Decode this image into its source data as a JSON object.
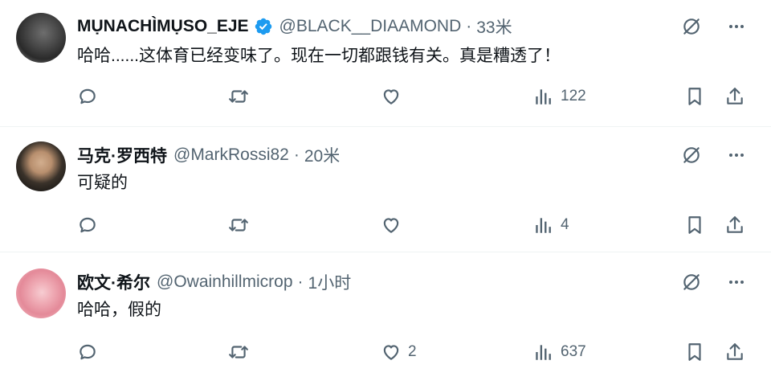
{
  "tweets": [
    {
      "name": "MỤNACHÌMỤSO_EJE",
      "handle": "@BLACK__DIAAMOND",
      "dot": "·",
      "time": "33米",
      "verified": true,
      "text": "哈哈......这体育已经变味了。现在一切都跟钱有关。真是糟透了！",
      "likes": "",
      "views": "122",
      "avatar_colors": [
        "#3a3a3a",
        "#8a8a8a"
      ]
    },
    {
      "name": "马克·罗西特",
      "handle": "@MarkRossi82",
      "dot": "·",
      "time": "20米",
      "verified": false,
      "text": "可疑的",
      "likes": "",
      "views": "4",
      "avatar_colors": [
        "#2b2620",
        "#c9a98a"
      ]
    },
    {
      "name": "欧文·希尔",
      "handle": "@Owainhillmicrop",
      "dot": "·",
      "time": "1小时",
      "verified": false,
      "text": "哈哈，假的",
      "likes": "2",
      "views": "637",
      "avatar_colors": [
        "#e89aa6",
        "#f6c6cc"
      ]
    }
  ],
  "icons": {
    "verified": "verified-badge-icon",
    "grok": "grok-icon",
    "more": "more-icon",
    "reply": "reply-icon",
    "retweet": "retweet-icon",
    "like": "like-icon",
    "views": "views-icon",
    "bookmark": "bookmark-icon",
    "share": "share-icon"
  },
  "colors": {
    "text": "#0f1419",
    "secondary": "#536471",
    "verified": "#1d9bf0",
    "divider": "#eff3f4"
  }
}
